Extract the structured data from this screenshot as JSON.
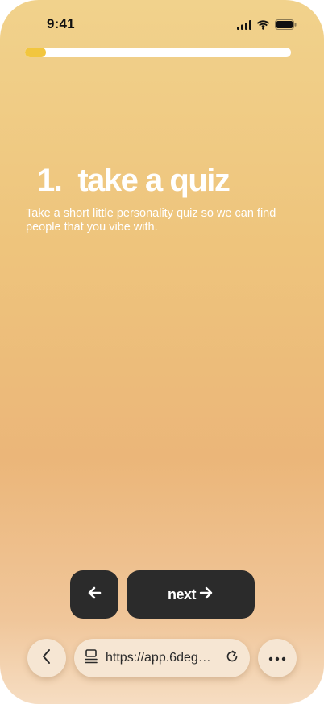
{
  "status_bar": {
    "time": "9:41",
    "icons": [
      "cellular-signal-icon",
      "wifi-icon",
      "battery-icon"
    ]
  },
  "progress": {
    "fraction": 0.08,
    "fill_color": "#f2c63e",
    "track_color": "#ffffff"
  },
  "step": {
    "number": "1.",
    "title": "take a quiz",
    "description": "Take a short little personality quiz so we can find people that you vibe with."
  },
  "navigation": {
    "back_icon": "arrow-left-icon",
    "next_label": "next",
    "next_icon": "arrow-right-icon"
  },
  "browser": {
    "url": "https://app.6degrees.social",
    "back_icon": "chevron-left-icon",
    "tabs_icon": "tabs-icon",
    "reload_icon": "reload-icon",
    "more_icon": "more-icon"
  },
  "colors": {
    "button_dark": "#2b2b2b",
    "text_light": "#ffffff",
    "pill_bg": "#f6e6d3"
  }
}
